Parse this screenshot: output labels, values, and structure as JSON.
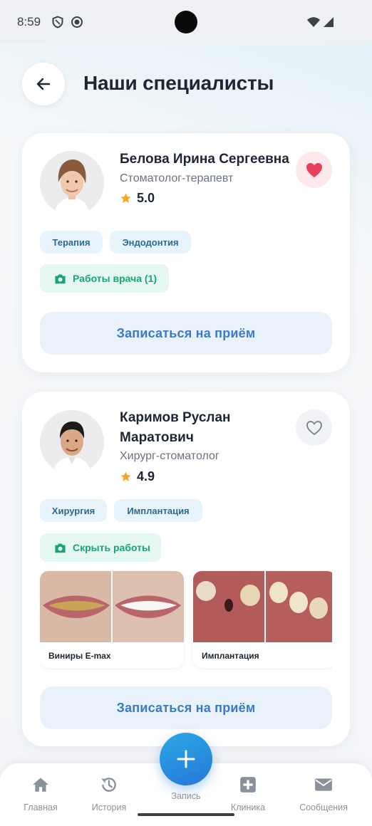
{
  "status_bar": {
    "time": "8:59",
    "icons": [
      "shield-icon",
      "face-icon",
      "wifi-icon",
      "signal-icon"
    ]
  },
  "header": {
    "title": "Наши специалисты",
    "back_icon": "arrow-left-icon"
  },
  "doctors": [
    {
      "name": "Белова Ирина Сергеевна",
      "role": "Стоматолог-терапевт",
      "rating": "5.0",
      "favorite": true,
      "tags": [
        "Терапия",
        "Эндодонтия"
      ],
      "works_button": "Работы врача (1)",
      "book_button": "Записаться на приём"
    },
    {
      "name": "Каримов Руслан Маратович",
      "role": "Хирург-стоматолог",
      "rating": "4.9",
      "favorite": false,
      "tags": [
        "Хирургия",
        "Имплантация"
      ],
      "works_button": "Скрыть работы",
      "works": [
        {
          "label": "Виниры E-max"
        },
        {
          "label": "Имплантация"
        }
      ],
      "book_button": "Записаться на приём"
    }
  ],
  "nav": {
    "items": [
      {
        "label": "Главная",
        "icon": "home-icon"
      },
      {
        "label": "История",
        "icon": "history-icon"
      },
      {
        "label": "Запись",
        "icon": "plus-icon"
      },
      {
        "label": "Клиника",
        "icon": "clinic-icon"
      },
      {
        "label": "Сообщения",
        "icon": "mail-icon"
      }
    ]
  },
  "colors": {
    "accent": "#3b7bc6",
    "favorite": "#e8405a",
    "green": "#17a673",
    "star": "#f5a623"
  }
}
